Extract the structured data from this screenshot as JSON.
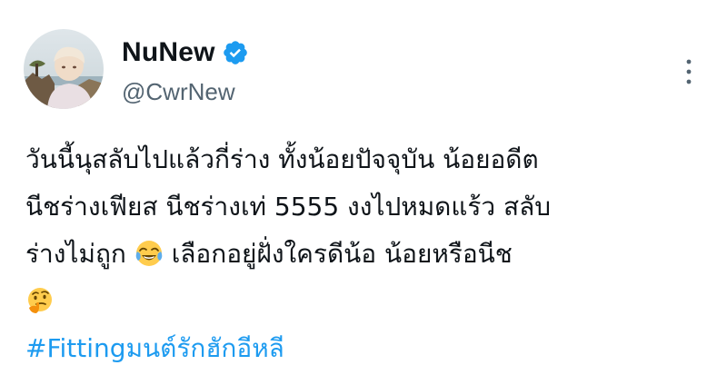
{
  "author": {
    "display_name": "NuNew",
    "handle": "@CwrNew",
    "verified": true,
    "verified_color": "#1d9bf0",
    "avatar_icon": "profile-photo"
  },
  "menu": {
    "icon": "more-options-icon"
  },
  "tweet": {
    "line1": "วันนี้นุสลับไปแล้วกี่ร่าง ทั้งน้อยปัจจุบัน น้อยอดีต",
    "line2": "นีชร่างเฟียส นีชร่างเท่ 5555 งงไปหมดแร้ว สลับ",
    "line3_a": "ร่างไม่ถูก",
    "line3_emoji": "face-with-tears-of-joy-emoji",
    "line3_b": "เลือกอยู่ฝั่งใครดีน้อ น้อยหรือนีช",
    "line4_emoji": "thinking-face-emoji",
    "hashtag": "#Fittingมนต์รักฮักอีหลี",
    "hashtag_color": "#1d9bf0"
  }
}
